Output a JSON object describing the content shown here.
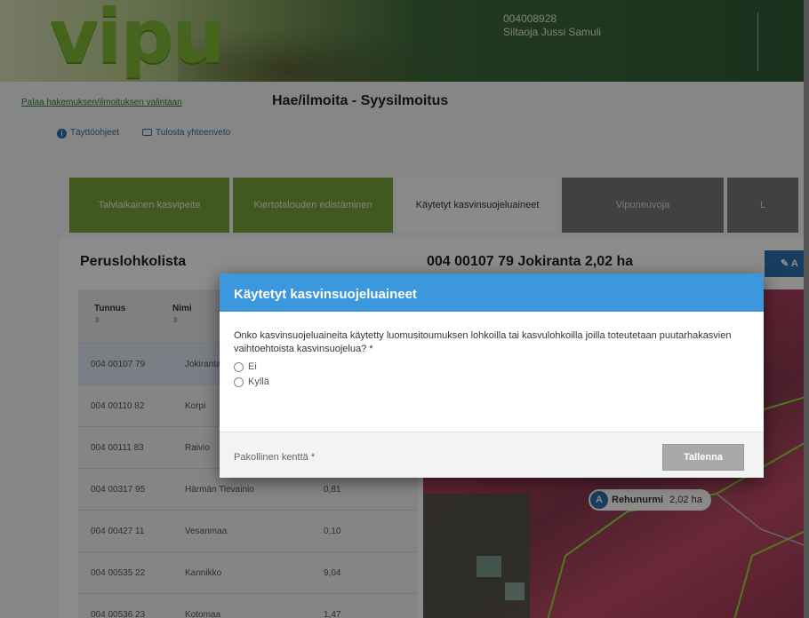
{
  "header": {
    "logo": "vipu",
    "user_id": "004008928",
    "user_name": "Siltaoja Jussi Samuli"
  },
  "page": {
    "back_link": "Palaa hakemuksen/ilmoituksen valintaan",
    "title": "Hae/ilmoita - Syysilmoitus",
    "toolbar": {
      "help": "Täyttöohjeet",
      "print": "Tulosta yhteenveto"
    },
    "tabs": [
      {
        "label": "Talviaikainen kasvipeite"
      },
      {
        "label": "Kiertotalouden edistäminen"
      },
      {
        "label": "Käytetyt kasvinsuojeluaineet"
      },
      {
        "label": "Vipuneuvoja"
      },
      {
        "label": "L"
      }
    ]
  },
  "panel": {
    "left_title": "Peruslohkolista",
    "right_title": "004 00107 79 Jokiranta 2,02 ha",
    "edit_button": "A",
    "table": {
      "columns": [
        "Tunnus",
        "Nimi"
      ],
      "sort_marks": [
        "⇕",
        "⇕"
      ],
      "rows": [
        {
          "id": "004 00107 79",
          "name": "Jokiranta",
          "area": ""
        },
        {
          "id": "004 00110 82",
          "name": "Korpi",
          "area": ""
        },
        {
          "id": "004 00111 83",
          "name": "Raivio",
          "area": ""
        },
        {
          "id": "004 00317 95",
          "name": "Härmän Tievainio",
          "area": "0,81"
        },
        {
          "id": "004 00427 11",
          "name": "Vesanmaa",
          "area": "0,10"
        },
        {
          "id": "004 00535 22",
          "name": "Kannikko",
          "area": "9,04"
        },
        {
          "id": "004 00536 23",
          "name": "Kotomaa",
          "area": "1,47"
        }
      ]
    },
    "map_label": {
      "badge": "A",
      "name": "Rehunurmi",
      "area": "2,02 ha"
    }
  },
  "modal": {
    "title": "Käytetyt kasvinsuojeluaineet",
    "question": "Onko kasvinsuojeluaineita käytetty luomusitoumuksen lohkoilla tai kasvulohkoilla joilla toteutetaan puutarhakasvien vaihtoehtoista kasvinsuojelua? *",
    "options": [
      "Ei",
      "Kyllä"
    ],
    "required_note": "Pakollinen kenttä",
    "required_star": "*",
    "save_label": "Tallenna"
  },
  "colors": {
    "modal_header": "#3d97dc",
    "tab_green": "#77a23d",
    "logo_green": "#7cb832",
    "link_blue": "#2a6fae"
  }
}
